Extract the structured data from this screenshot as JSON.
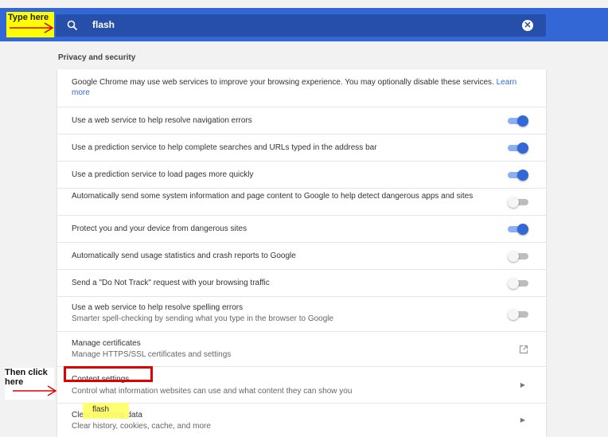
{
  "header": {
    "search_value": "flash",
    "search_icon": "search-icon",
    "clear_icon": "close-circle-icon"
  },
  "annotations": {
    "type_here": "Type here",
    "then_click_here": "Then click here",
    "flash_tip": "flash",
    "arrow_color": "#e00000",
    "highlight_color": "#ffff00"
  },
  "section": {
    "title": "Privacy and security"
  },
  "rows": [
    {
      "text": "Google Chrome may use web services to improve your browsing experience. You may optionally disable these services.",
      "link": "Learn more"
    },
    {
      "text": "Use a web service to help resolve navigation errors",
      "toggle": "on"
    },
    {
      "text": "Use a prediction service to help complete searches and URLs typed in the address bar",
      "toggle": "on"
    },
    {
      "text": "Use a prediction service to load pages more quickly",
      "toggle": "on"
    },
    {
      "text": "Automatically send some system information and page content to Google to help detect dangerous apps and sites",
      "toggle": "off"
    },
    {
      "text": "Protect you and your device from dangerous sites",
      "toggle": "on"
    },
    {
      "text": "Automatically send usage statistics and crash reports to Google",
      "toggle": "off"
    },
    {
      "text": "Send a \"Do Not Track\" request with your browsing traffic",
      "toggle": "off"
    },
    {
      "text": "Use a web service to help resolve spelling errors",
      "sub": "Smarter spell-checking by sending what you type in the browser to Google",
      "toggle": "off"
    },
    {
      "text": "Manage certificates",
      "sub": "Manage HTTPS/SSL certificates and settings",
      "icon": "external-link-icon"
    },
    {
      "text": "Content settings",
      "sub": "Control what information websites can use and what content they can show you",
      "icon": "chevron-right-icon"
    },
    {
      "text": "Clear browsing data",
      "sub": "Clear history, cookies, cache, and more",
      "icon": "chevron-right-icon"
    }
  ],
  "colors": {
    "accent": "#3367d6",
    "header_bg": "#3367d6",
    "search_bg": "#254fa8"
  }
}
